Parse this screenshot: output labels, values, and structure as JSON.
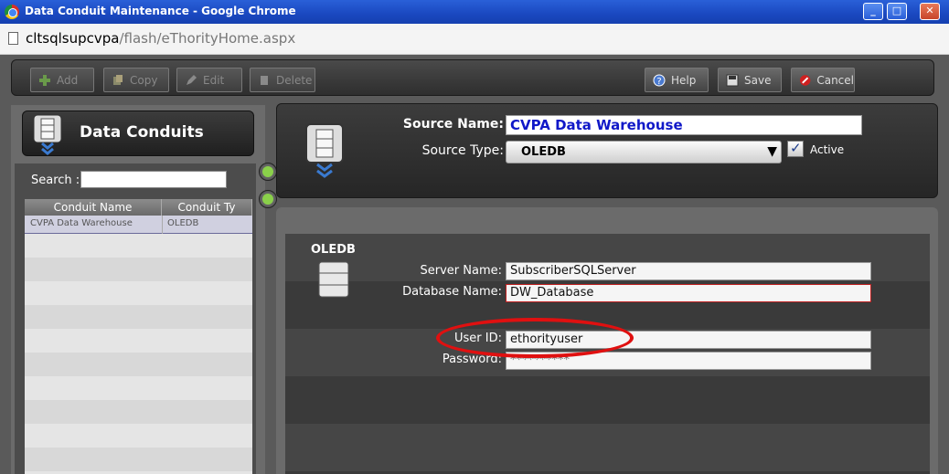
{
  "window": {
    "title": "Data Conduit Maintenance - Google Chrome",
    "minimize": "_",
    "maximize": "□",
    "close": "✕"
  },
  "address": {
    "host": "cltsqlsupcvpa",
    "path": "/flash/eThorityHome.aspx"
  },
  "toolbar": {
    "add": "Add",
    "copy": "Copy",
    "edit": "Edit",
    "delete": "Delete",
    "help": "Help",
    "save": "Save",
    "cancel": "Cancel"
  },
  "left": {
    "title": "Data Conduits",
    "search_label": "Search :",
    "search_value": "",
    "columns": [
      "Conduit Name",
      "Conduit Ty"
    ],
    "rows": [
      {
        "name": "CVPA Data Warehouse",
        "type": "OLEDB"
      }
    ]
  },
  "source": {
    "name_label": "Source Name:",
    "name_value": "CVPA Data Warehouse",
    "type_label": "Source Type:",
    "type_value": "OLEDB",
    "active_label": "Active",
    "active_checked": true
  },
  "oledb": {
    "title": "OLEDB",
    "server_label": "Server Name:",
    "server_value": "SubscriberSQLServer",
    "database_label": "Database Name:",
    "database_value": "DW_Database",
    "user_label": "User ID:",
    "user_value": "ethorityuser",
    "password_label": "Password:",
    "password_value": "**********"
  },
  "colors": {
    "title_bar": "#1a48c0",
    "source_name_text": "#1018c8",
    "highlight": "#e01010"
  }
}
